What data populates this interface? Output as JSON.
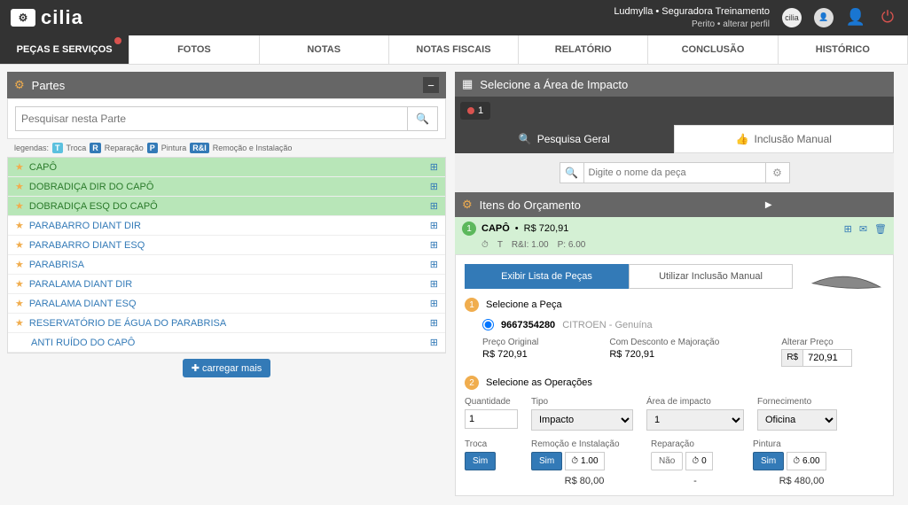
{
  "header": {
    "logo_text": "cilia",
    "user_name": "Ludmylla • Seguradora Treinamento",
    "user_role": "Perito",
    "change_profile": "alterar perfil"
  },
  "tabs": {
    "pecas": "PEÇAS E SERVIÇOS",
    "fotos": "FOTOS",
    "notas": "NOTAS",
    "notas_fiscais": "NOTAS FISCAIS",
    "relatorio": "RELATÓRIO",
    "conclusao": "CONCLUSÃO",
    "historico": "HISTÓRICO"
  },
  "partes": {
    "title": "Partes",
    "search_placeholder": "Pesquisar nesta Parte",
    "legends_label": "legendas:",
    "legend_troca": "Troca",
    "legend_reparacao": "Reparação",
    "legend_pintura": "Pintura",
    "legend_remocao": "Remoção e Instalação",
    "items": [
      {
        "name": "CAPÔ",
        "green": true,
        "star": true
      },
      {
        "name": "DOBRADIÇA DIR DO CAPÔ",
        "green": true,
        "star": true
      },
      {
        "name": "DOBRADIÇA ESQ DO CAPÔ",
        "green": true,
        "star": true
      },
      {
        "name": "PARABARRO DIANT DIR",
        "green": false,
        "star": true
      },
      {
        "name": "PARABARRO DIANT ESQ",
        "green": false,
        "star": true
      },
      {
        "name": "PARABRISA",
        "green": false,
        "star": true
      },
      {
        "name": "PARALAMA DIANT DIR",
        "green": false,
        "star": true
      },
      {
        "name": "PARALAMA DIANT ESQ",
        "green": false,
        "star": true
      },
      {
        "name": "RESERVATÓRIO DE ÁGUA DO PARABRISA",
        "green": false,
        "star": true
      },
      {
        "name": "ANTI RUÍDO DO CAPÔ",
        "green": false,
        "star": false
      }
    ],
    "load_more": "carregar mais"
  },
  "impact": {
    "title": "Selecione a Área de Impacto",
    "area_1": "1"
  },
  "search": {
    "pesquisa_geral": "Pesquisa Geral",
    "inclusao_manual": "Inclusão Manual",
    "placeholder": "Digite o nome da peça"
  },
  "orcamento": {
    "title": "Itens do Orçamento",
    "item_num": "1",
    "item_name": "CAPÔ",
    "item_price": "R$ 720,91",
    "item_t": "T",
    "item_rei": "R&I: 1.00",
    "item_p": "P: 6.00",
    "exibir_lista": "Exibir Lista de Peças",
    "utilizar_manual": "Utilizar Inclusão Manual",
    "step1": "Selecione a Peça",
    "part_code": "9667354280",
    "part_maker": "CITROEN - Genuína",
    "preco_original_label": "Preço Original",
    "preco_original": "R$ 720,91",
    "com_desconto_label": "Com Desconto e Majoração",
    "com_desconto": "R$ 720,91",
    "alterar_preco_label": "Alterar Preço",
    "alterar_preco_prefix": "R$",
    "alterar_preco_value": "720,91",
    "step2": "Selecione as Operações",
    "quantidade_label": "Quantidade",
    "quantidade_value": "1",
    "tipo_label": "Tipo",
    "tipo_value": "Impacto",
    "area_label": "Área de impacto",
    "area_value": "1",
    "fornecimento_label": "Fornecimento",
    "fornecimento_value": "Oficina",
    "troca_label": "Troca",
    "sim": "Sim",
    "nao": "Não",
    "remocao_label": "Remoção e Instalação",
    "remocao_time": "1.00",
    "remocao_total": "R$ 80,00",
    "reparacao_label": "Reparação",
    "reparacao_time": "0",
    "reparacao_total": "-",
    "pintura_label": "Pintura",
    "pintura_time": "6.00",
    "pintura_total": "R$ 480,00"
  }
}
